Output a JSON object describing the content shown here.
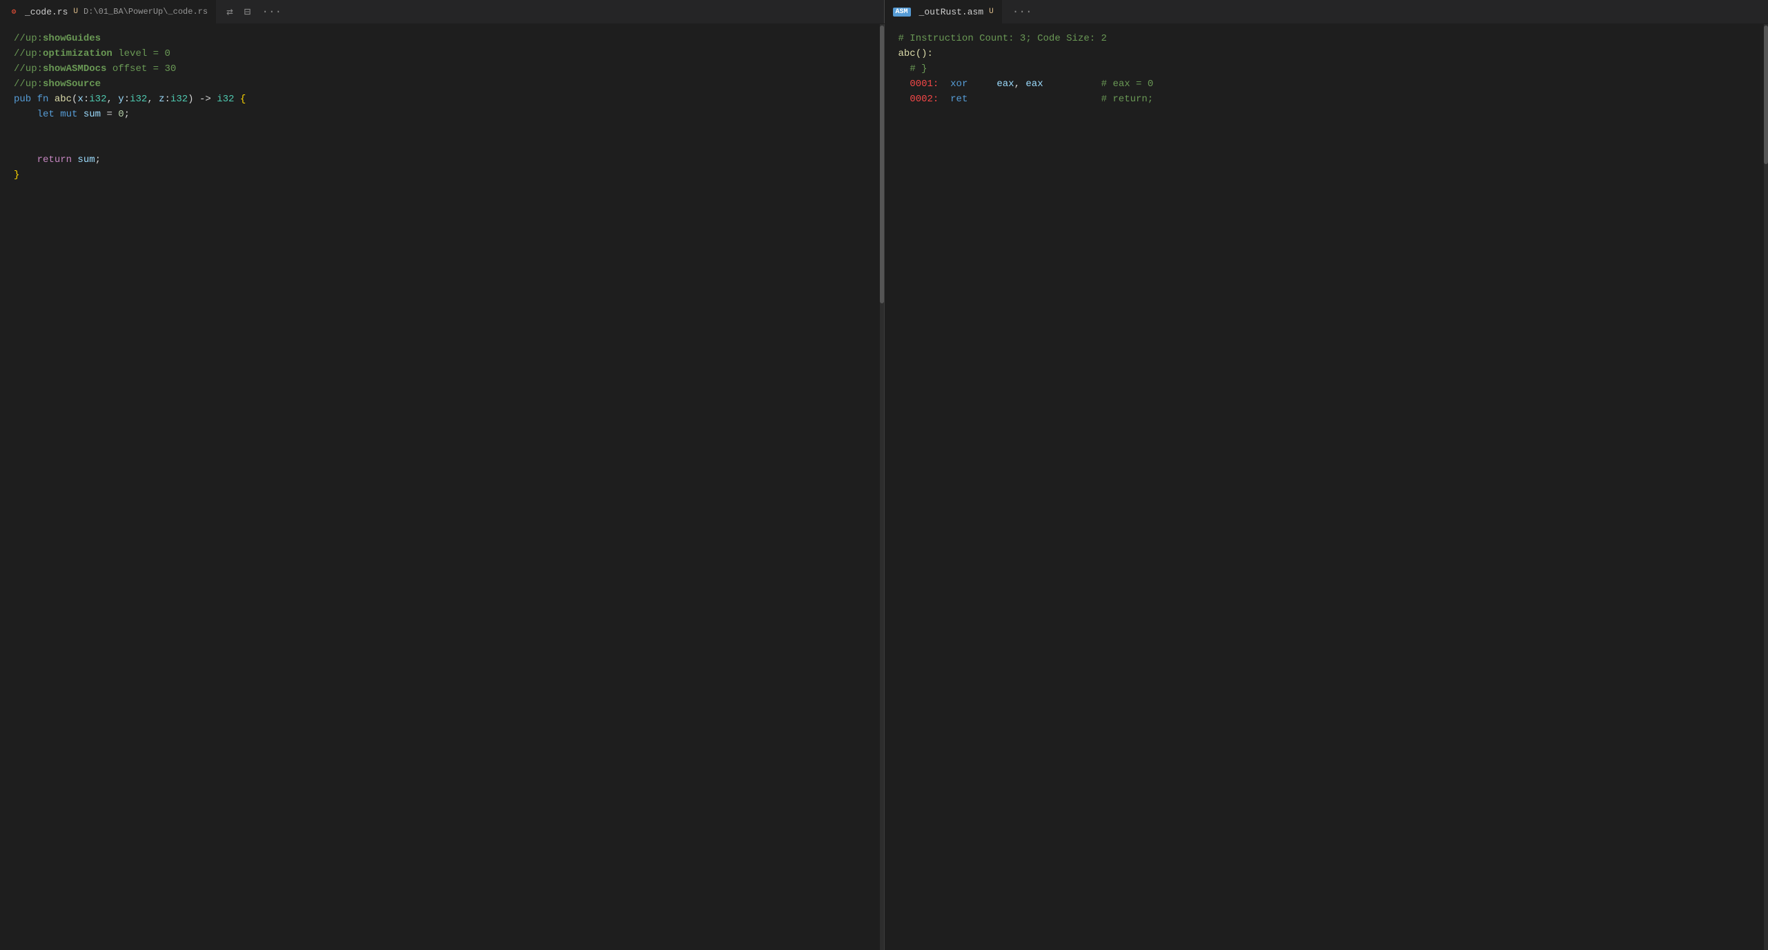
{
  "left_tab": {
    "icon": "⚙",
    "filename": "_code.rs",
    "modified_indicator": "U",
    "path": "D:\\01_BA\\PowerUp\\_code.rs"
  },
  "right_tab": {
    "badge": "ASM",
    "filename": "_outRust.asm",
    "modified_indicator": "U"
  },
  "left_code": [
    {
      "id": 1,
      "raw": "//up:showGuides"
    },
    {
      "id": 2,
      "raw": "//up:optimization level = 0"
    },
    {
      "id": 3,
      "raw": "//up:showASMDocs offset = 30"
    },
    {
      "id": 4,
      "raw": "//up:showSource"
    },
    {
      "id": 5,
      "raw": "pub fn abc(x:i32, y:i32, z:i32) -> i32 {"
    },
    {
      "id": 6,
      "raw": "    let mut sum = 0;"
    },
    {
      "id": 7,
      "raw": ""
    },
    {
      "id": 8,
      "raw": ""
    },
    {
      "id": 9,
      "raw": "    return sum;"
    },
    {
      "id": 10,
      "raw": "}"
    }
  ],
  "right_code": [
    {
      "id": 1,
      "raw": "# Instruction Count: 3; Code Size: 2"
    },
    {
      "id": 2,
      "raw": "abc():"
    },
    {
      "id": 3,
      "raw": "  # }"
    },
    {
      "id": 4,
      "raw": "  0001:  xor     eax, eax          # eax = 0"
    },
    {
      "id": 5,
      "raw": "  0002:  ret                       # return;"
    }
  ],
  "actions": {
    "sync_scroll": "⇄",
    "split": "⊟",
    "more": "..."
  }
}
